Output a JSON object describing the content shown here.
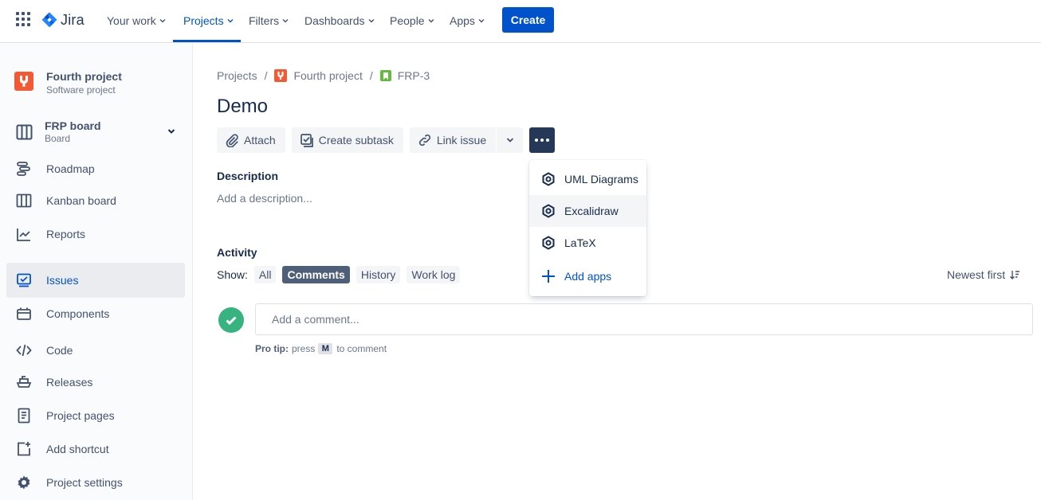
{
  "nav": {
    "logo_text": "Jira",
    "items": [
      {
        "label": "Your work"
      },
      {
        "label": "Projects"
      },
      {
        "label": "Filters"
      },
      {
        "label": "Dashboards"
      },
      {
        "label": "People"
      },
      {
        "label": "Apps"
      }
    ],
    "active_item": "Projects",
    "create_label": "Create",
    "accent_color": "#0052cc"
  },
  "sidebar": {
    "project_name": "Fourth project",
    "project_type": "Software project",
    "board_name": "FRP board",
    "board_type": "Board",
    "items": [
      {
        "label": "Roadmap",
        "icon": "roadmap-icon"
      },
      {
        "label": "Kanban board",
        "icon": "kanban-icon"
      },
      {
        "label": "Reports",
        "icon": "reports-icon"
      },
      {
        "label": "Issues",
        "icon": "issues-icon",
        "selected": true
      },
      {
        "label": "Components",
        "icon": "components-icon"
      },
      {
        "label": "Code",
        "icon": "code-icon"
      },
      {
        "label": "Releases",
        "icon": "releases-icon"
      },
      {
        "label": "Project pages",
        "icon": "project-pages-icon"
      },
      {
        "label": "Add shortcut",
        "icon": "add-shortcut-icon"
      },
      {
        "label": "Project settings",
        "icon": "gear-icon"
      }
    ]
  },
  "breadcrumb": {
    "projects": "Projects",
    "project": "Fourth project",
    "issue_key": "FRP-3"
  },
  "issue": {
    "title": "Demo"
  },
  "toolbar": {
    "attach": "Attach",
    "create_subtask": "Create subtask",
    "link_issue": "Link issue"
  },
  "description": {
    "label": "Description",
    "placeholder": "Add a description..."
  },
  "activity": {
    "label": "Activity",
    "show_label": "Show:",
    "filters": [
      "All",
      "Comments",
      "History",
      "Work log"
    ],
    "active_filter": "Comments",
    "sort_label": "Newest first",
    "comment_placeholder": "Add a comment...",
    "protip_bold": "Pro tip:",
    "protip_press": "press",
    "protip_key": "M",
    "protip_rest": "to comment"
  },
  "more_menu": {
    "items": [
      {
        "label": "UML Diagrams",
        "icon": "app-hexagon-icon"
      },
      {
        "label": "Excalidraw",
        "icon": "app-hexagon-icon",
        "hovered": true
      },
      {
        "label": "LaTeX",
        "icon": "app-hexagon-icon"
      }
    ],
    "add_apps": "Add apps"
  }
}
